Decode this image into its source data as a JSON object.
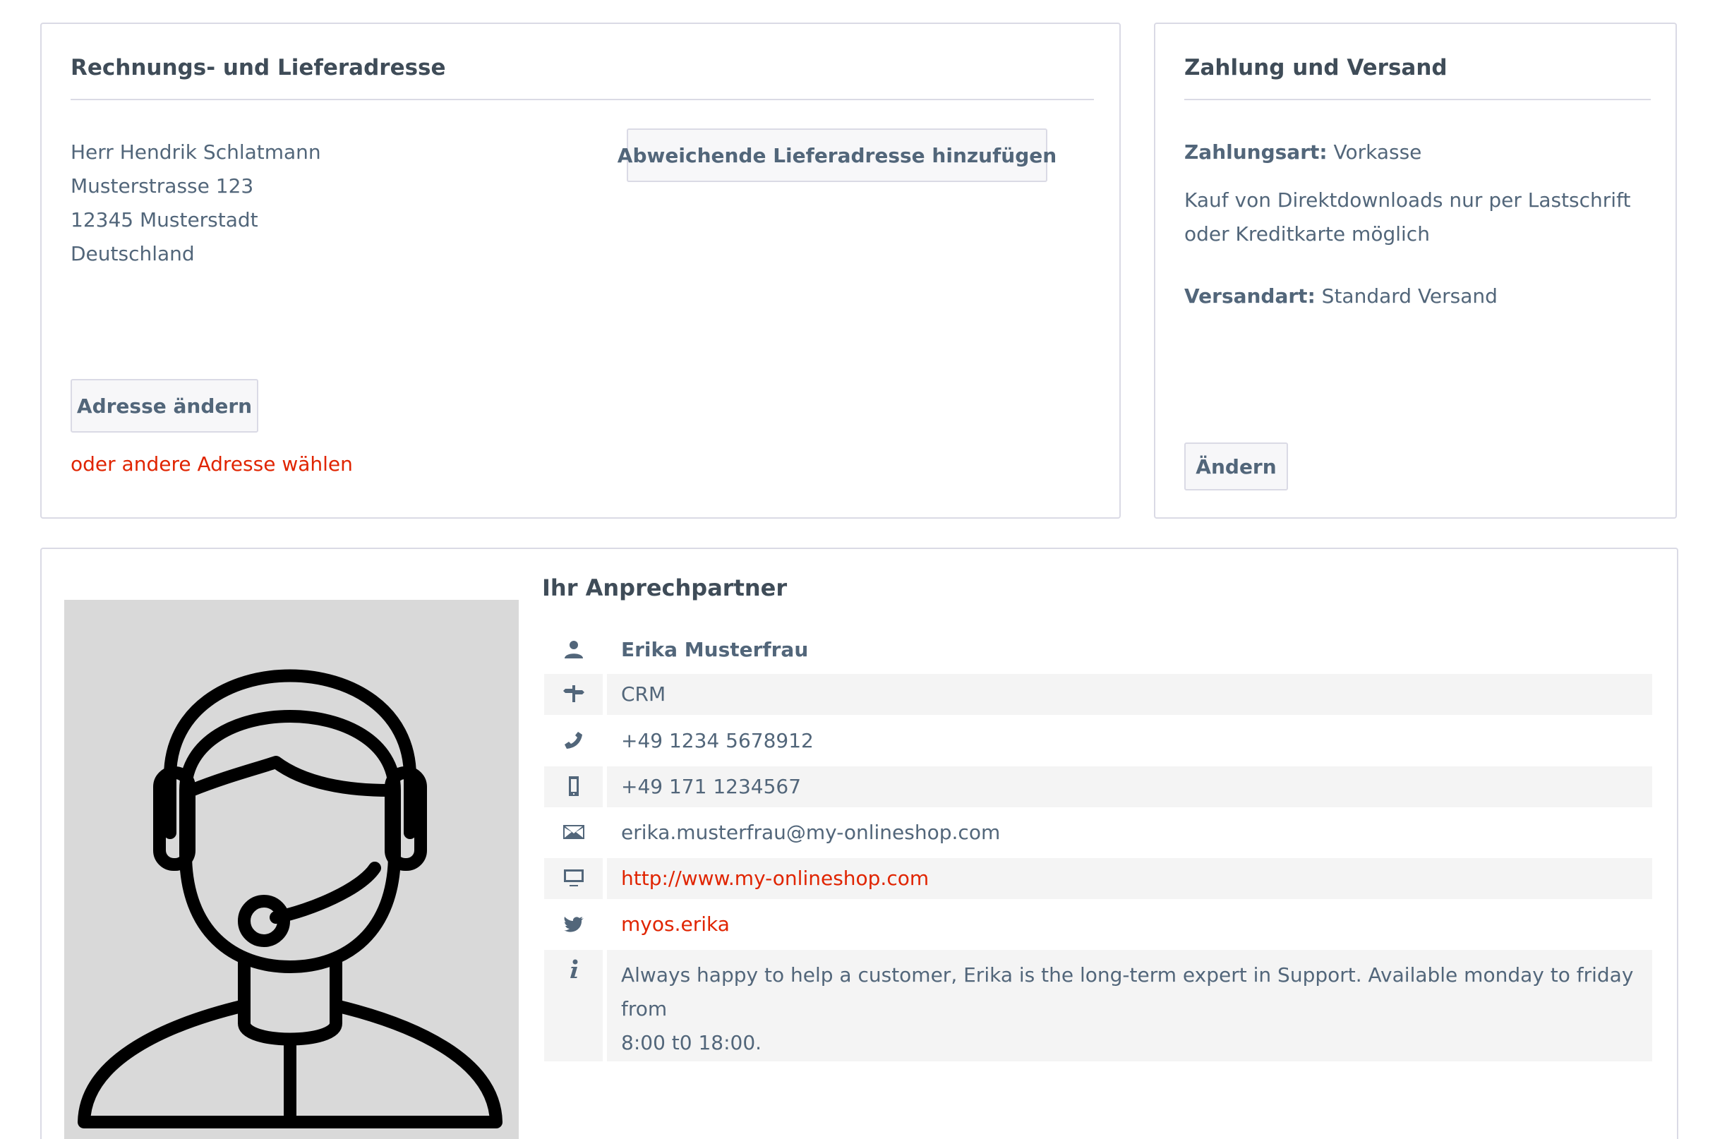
{
  "billing": {
    "title": "Rechnungs- und Lieferadresse",
    "address_lines": [
      "Herr Hendrik Schlatmann",
      "Musterstrasse 123",
      "12345 Musterstadt",
      "Deutschland"
    ],
    "add_shipping_button": "Abweichende Lieferadresse hinzufügen",
    "change_address_button": "Adresse ändern",
    "other_address_link": "oder andere Adresse wählen"
  },
  "payment": {
    "title": "Zahlung und Versand",
    "payment_method_label": "Zahlungsart:",
    "payment_method_value": "Vorkasse",
    "note_line1": "Kauf von Direktdownloads nur per Lastschrift",
    "note_line2": "oder Kreditkarte möglich",
    "shipping_method_label": "Versandart:",
    "shipping_method_value": "Standard Versand",
    "change_button": "Ändern"
  },
  "contact": {
    "heading": "Ihr Anprechpartner",
    "name": "Erika Musterfrau",
    "department": "CRM",
    "phone": "+49 1234 5678912",
    "mobile": "+49 171 1234567",
    "email": "erika.musterfrau@my-onlineshop.com",
    "website": "http://www.my-onlineshop.com",
    "twitter": "myos.erika",
    "info_line1": "Always happy to help a customer, Erika is the long-term expert in Support. Available monday to friday from",
    "info_line2": "8:00 t0 18:00.",
    "icons": [
      "user-icon",
      "signpost-icon",
      "phone-icon",
      "mobile-icon",
      "envelope-icon",
      "desktop-icon",
      "twitter-icon",
      "info-icon"
    ]
  },
  "colors": {
    "accent_link": "#e02400",
    "text": "#52667a",
    "heading": "#3f4c58",
    "border": "#dadae5",
    "row_shade": "#f4f4f4",
    "avatar_bg": "#d9d9d9"
  }
}
